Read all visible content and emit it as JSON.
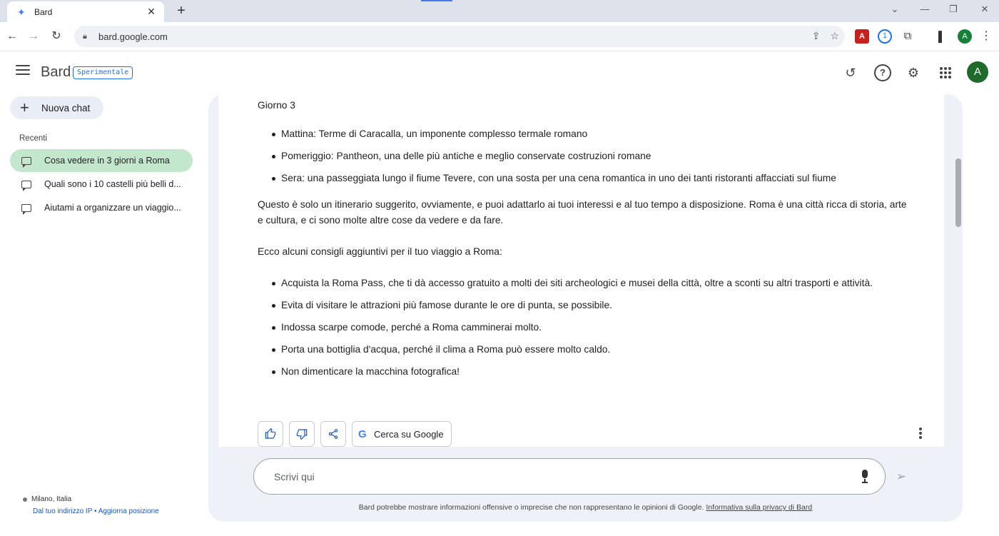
{
  "browser": {
    "tab_title": "Bard",
    "url": "bard.google.com"
  },
  "header": {
    "brand": "Bard",
    "badge": "Sperimentale",
    "avatar_letter": "A"
  },
  "sidebar": {
    "new_chat_label": "Nuova chat",
    "recent_heading": "Recenti",
    "recent_items": [
      {
        "label": "Cosa vedere in 3 giorni a Roma",
        "active": true
      },
      {
        "label": "Quali sono i 10 castelli più belli d...",
        "active": false
      },
      {
        "label": "Aiutami a organizzare un viaggio...",
        "active": false
      }
    ],
    "location_name": "Milano, Italia",
    "location_source": "Dal tuo indirizzo IP",
    "location_separator": " • ",
    "location_update": "Aggiorna posizione"
  },
  "message": {
    "day_heading": "Giorno 3",
    "day_items": [
      "Mattina: Terme di Caracalla, un imponente complesso termale romano",
      "Pomeriggio: Pantheon, una delle più antiche e meglio conservate costruzioni romane",
      "Sera: una passeggiata lungo il fiume Tevere, con una sosta per una cena romantica in uno dei tanti ristoranti affacciati sul fiume"
    ],
    "paragraph_1": "Questo è solo un itinerario suggerito, ovviamente, e puoi adattarlo ai tuoi interessi e al tuo tempo a disposizione. Roma è una città ricca di storia, arte e cultura, e ci sono molte altre cose da vedere e da fare.",
    "paragraph_2": "Ecco alcuni consigli aggiuntivi per il tuo viaggio a Roma:",
    "tips": [
      "Acquista la Roma Pass, che ti dà accesso gratuito a molti dei siti archeologici e musei della città, oltre a sconti su altri trasporti e attività.",
      "Evita di visitare le attrazioni più famose durante le ore di punta, se possibile.",
      "Indossa scarpe comode, perché a Roma camminerai molto.",
      "Porta una bottiglia d'acqua, perché il clima a Roma può essere molto caldo.",
      "Non dimenticare la macchina fotografica!"
    ]
  },
  "actions": {
    "google_search_label": "Cerca su Google",
    "icons": [
      "thumbs-up-icon",
      "thumbs-down-icon",
      "share-icon",
      "more-vert-icon"
    ]
  },
  "input": {
    "placeholder": "Scrivi qui",
    "value": ""
  },
  "footer": {
    "disclaimer": "Bard potrebbe mostrare informazioni offensive o imprecise che non rappresentano le opinioni di Google.",
    "privacy_link": "Informativa sulla privacy di Bard"
  },
  "colors": {
    "active_chat_bg": "#c2e7cd",
    "panel_bg": "#eef2f8",
    "link": "#1a57c4",
    "avatar": "#1e6b2c"
  }
}
